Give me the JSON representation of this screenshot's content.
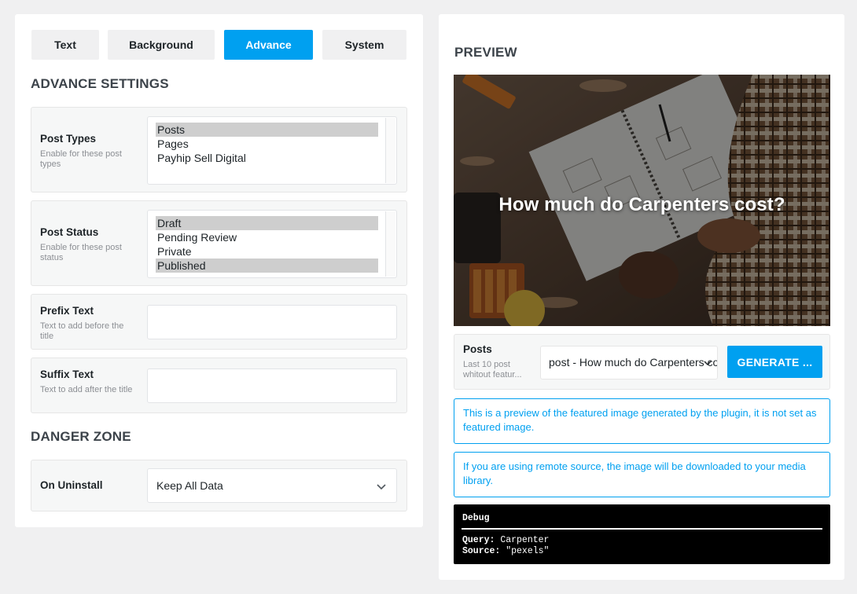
{
  "tabs": [
    {
      "label": "Text",
      "active": false
    },
    {
      "label": "Background",
      "active": false
    },
    {
      "label": "Advance",
      "active": true
    },
    {
      "label": "System",
      "active": false
    }
  ],
  "advance": {
    "title": "ADVANCE SETTINGS",
    "post_types": {
      "label": "Post Types",
      "description": "Enable for these post types",
      "options": [
        {
          "label": "Posts",
          "selected": true
        },
        {
          "label": "Pages",
          "selected": false
        },
        {
          "label": "Payhip Sell Digital",
          "selected": false
        }
      ]
    },
    "post_status": {
      "label": "Post Status",
      "description": "Enable for these post status",
      "options": [
        {
          "label": "Draft",
          "selected": true
        },
        {
          "label": "Pending Review",
          "selected": false
        },
        {
          "label": "Private",
          "selected": false
        },
        {
          "label": "Published",
          "selected": true
        }
      ]
    },
    "prefix": {
      "label": "Prefix Text",
      "description": "Text to add before the title",
      "value": ""
    },
    "suffix": {
      "label": "Suffix Text",
      "description": "Text to add after the title",
      "value": ""
    }
  },
  "danger": {
    "title": "DANGER ZONE",
    "uninstall": {
      "label": "On Uninstall",
      "value": "Keep All Data"
    }
  },
  "preview": {
    "title": "PREVIEW",
    "image_headline": "How much do Carpenters cost?",
    "posts": {
      "label": "Posts",
      "description": "Last 10 post whitout featur...",
      "selected": "post - How much do Carpenters cost?"
    },
    "generate_label": "GENERATE ...",
    "notice_1": "This is a preview of the featured image generated by the plugin, it is not set as featured image.",
    "notice_2": "If you are using remote source, the image will be downloaded to your media library.",
    "debug": {
      "title": "Debug",
      "query_key": "Query:",
      "query_value": "Carpenter",
      "source_key": "Source:",
      "source_value": "\"pexels\""
    }
  },
  "colors": {
    "accent": "#00a0f0",
    "selected_option": "#cecece",
    "debug_background": "#000000"
  }
}
